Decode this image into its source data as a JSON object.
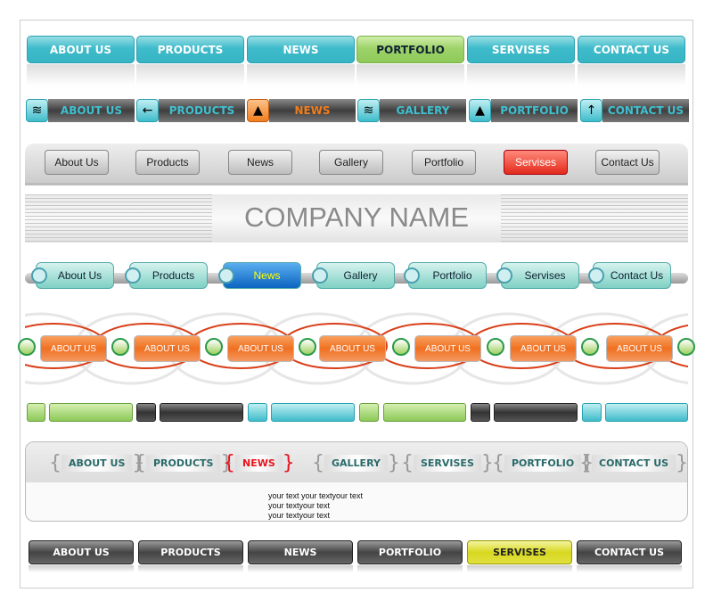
{
  "row1": {
    "items": [
      "ABOUT US",
      "PRODUCTS",
      "NEWS",
      "PORTFOLIO",
      "SERVISES",
      "CONTACT US"
    ],
    "active": 3
  },
  "row2": {
    "items": [
      {
        "label": "ABOUT US",
        "icon": "waves-icon"
      },
      {
        "label": "PRODUCTS",
        "icon": "arrow-left-icon"
      },
      {
        "label": "NEWS",
        "icon": "triangle-up-icon"
      },
      {
        "label": "GALLERY",
        "icon": "waves-icon"
      },
      {
        "label": "PORTFOLIO",
        "icon": "triangle-up-icon"
      },
      {
        "label": "CONTACT US",
        "icon": "arrow-up-icon"
      }
    ],
    "active": 2
  },
  "row3": {
    "items": [
      "About Us",
      "Products",
      "News",
      "Gallery",
      "Portfolio",
      "Servises",
      "Contact Us"
    ],
    "active": 5
  },
  "banner": {
    "title": "COMPANY NAME"
  },
  "row5": {
    "items": [
      "About Us",
      "Products",
      "News",
      "Gallery",
      "Portfolio",
      "Servises",
      "Contact Us"
    ],
    "active": 2
  },
  "row6": {
    "items": [
      "ABOUT US",
      "ABOUT US",
      "ABOUT US",
      "ABOUT US",
      "ABOUT US",
      "ABOUT US",
      "ABOUT US"
    ]
  },
  "row8": {
    "items": [
      "ABOUT US",
      "PRODUCTS",
      "NEWS",
      "GALLERY",
      "SERVISES",
      "PORTFOLIO",
      "CONTACT US"
    ],
    "active": 2,
    "text": [
      "your text your textyour text",
      "your textyour text",
      "your textyour text"
    ]
  },
  "row9": {
    "items": [
      "ABOUT US",
      "PRODUCTS",
      "NEWS",
      "PORTFOLIO",
      "SERVISES",
      "CONTACT US"
    ],
    "active": 4
  },
  "colors": {
    "teal": "#3fbccb",
    "green": "#9ed36a",
    "orange": "#f07d1e",
    "red": "#e32b1c",
    "blue": "#0b64c0",
    "yellow": "#d8d820"
  }
}
